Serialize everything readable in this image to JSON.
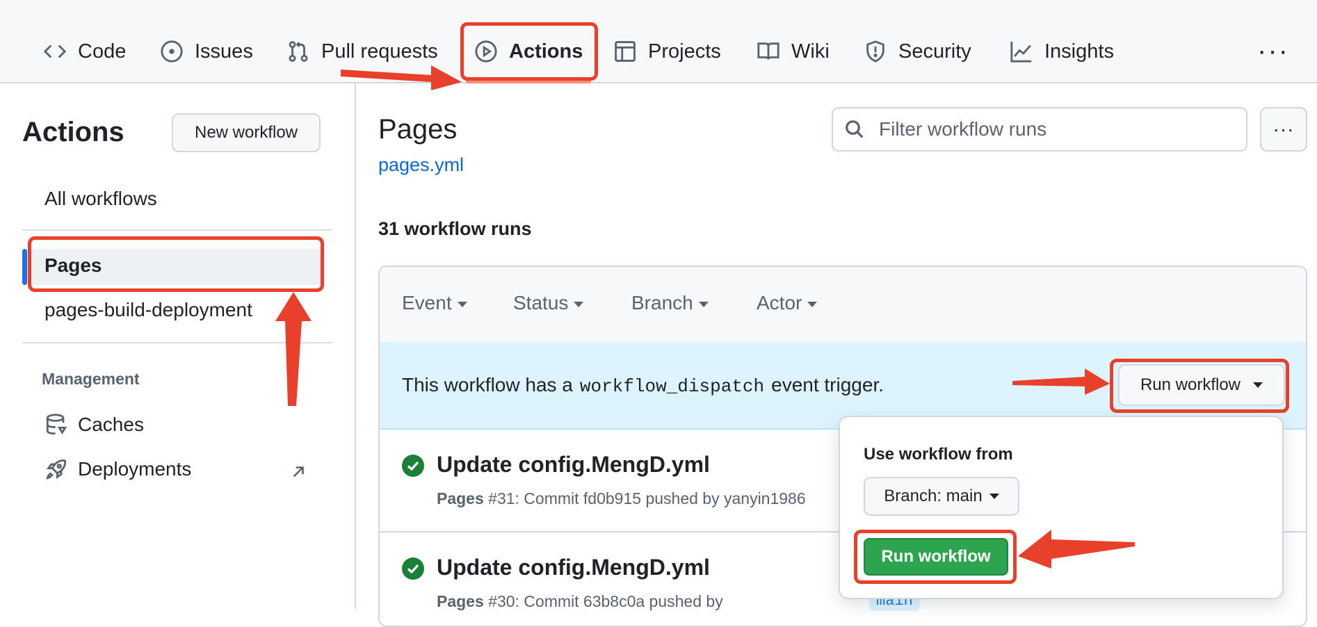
{
  "repo_nav": {
    "tabs": [
      {
        "label": "Code",
        "icon": "code-icon"
      },
      {
        "label": "Issues",
        "icon": "issue-opened-icon"
      },
      {
        "label": "Pull requests",
        "icon": "git-pull-request-icon"
      },
      {
        "label": "Actions",
        "icon": "play-icon",
        "active": true
      },
      {
        "label": "Projects",
        "icon": "table-icon"
      },
      {
        "label": "Wiki",
        "icon": "book-icon"
      },
      {
        "label": "Security",
        "icon": "shield-icon"
      },
      {
        "label": "Insights",
        "icon": "graph-icon"
      }
    ],
    "more": "···"
  },
  "sidebar": {
    "title": "Actions",
    "new_workflow": "New workflow",
    "items": [
      {
        "label": "All workflows"
      },
      {
        "label": "Pages",
        "selected": true
      },
      {
        "label": "pages-build-deployment"
      }
    ],
    "management_heading": "Management",
    "management_items": [
      {
        "label": "Caches",
        "icon": "database-icon"
      },
      {
        "label": "Deployments",
        "icon": "rocket-icon",
        "trailing_icon": "arrow-up-right-icon"
      }
    ]
  },
  "main": {
    "title": "Pages",
    "workflow_file": "pages.yml",
    "search_placeholder": "Filter workflow runs",
    "runs_count": "31 workflow runs",
    "filters": [
      "Event",
      "Status",
      "Branch",
      "Actor"
    ],
    "dispatch": {
      "prefix": "This workflow has a",
      "code": "workflow_dispatch",
      "suffix": "event trigger.",
      "button": "Run workflow"
    },
    "runs": [
      {
        "title": "Update config.MengD.yml",
        "workflow": "Pages",
        "meta": "#31: Commit fd0b915 pushed by yanyin1986",
        "status": "success"
      },
      {
        "title": "Update config.MengD.yml",
        "workflow": "Pages",
        "meta": "#30: Commit 63b8c0a pushed by",
        "status": "success",
        "branch": "main"
      }
    ]
  },
  "dropdown": {
    "heading": "Use workflow from",
    "branch_button": "Branch: main",
    "run_button": "Run workflow"
  },
  "colors": {
    "accent_blue": "#0969da",
    "success_green": "#2da44e",
    "annotation_red": "#e8402a",
    "dispatch_bg": "#ddf4ff"
  }
}
